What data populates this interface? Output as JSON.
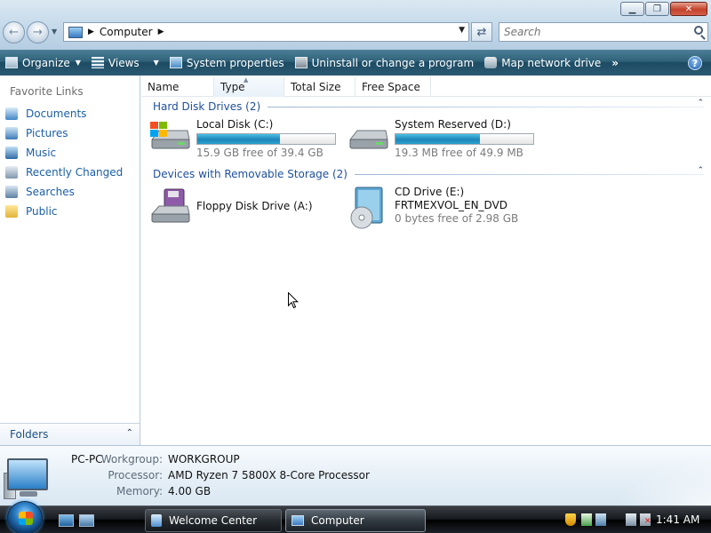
{
  "window": {
    "minimize_glyph": "▁",
    "maximize_glyph": "❐",
    "close_glyph": "✕"
  },
  "nav": {
    "back_glyph": "←",
    "forward_glyph": "→",
    "history_glyph": "▼"
  },
  "address": {
    "crumb_arrow": "▶",
    "crumb": "Computer",
    "crumb_trailing_arrow": "▶",
    "dropdown_glyph": "▼",
    "refresh_glyph": "⇄"
  },
  "search": {
    "placeholder": "Search"
  },
  "toolbar": {
    "organize": "Organize",
    "views": "Views",
    "system_properties": "System properties",
    "uninstall": "Uninstall or change a program",
    "map_network": "Map network drive",
    "more": "»",
    "help": "?",
    "dropdown_glyph": "▼"
  },
  "sidebar": {
    "title": "Favorite Links",
    "items": [
      {
        "label": "Documents",
        "icon": "documents-icon"
      },
      {
        "label": "Pictures",
        "icon": "pictures-icon"
      },
      {
        "label": "Music",
        "icon": "music-icon"
      },
      {
        "label": "Recently Changed",
        "icon": "recently-changed-icon"
      },
      {
        "label": "Searches",
        "icon": "searches-icon"
      },
      {
        "label": "Public",
        "icon": "public-folder-icon"
      }
    ],
    "folders_label": "Folders",
    "folders_chevron": "⌃"
  },
  "columns": {
    "name": "Name",
    "type": "Type",
    "total_size": "Total Size",
    "free_space": "Free Space",
    "sort_glyph": "▲"
  },
  "groups": {
    "hard_disks": "Hard Disk Drives (2)",
    "removable": "Devices with Removable Storage (2)",
    "collapse_glyph": "⌃"
  },
  "drives": {
    "c": {
      "name": "Local Disk (C:)",
      "free_text": "15.9 GB free of 39.4 GB",
      "used_fraction": 0.6
    },
    "d": {
      "name": "System Reserved (D:)",
      "free_text": "19.3 MB free of 49.9 MB",
      "used_fraction": 0.61
    },
    "a": {
      "name": "Floppy Disk Drive (A:)"
    },
    "e": {
      "name": "CD Drive (E:)",
      "label": "FRTMEXVOL_EN_DVD",
      "free_text": "0 bytes free of 2.98 GB"
    }
  },
  "details": {
    "pc_name": "PC-PC",
    "workgroup_label": "Workgroup:",
    "workgroup": "WORKGROUP",
    "processor_label": "Processor:",
    "processor": "AMD Ryzen 7 5800X 8-Core Processor",
    "memory_label": "Memory:",
    "memory": "4.00 GB"
  },
  "taskbar": {
    "buttons": [
      {
        "label": "Welcome Center"
      },
      {
        "label": "Computer"
      }
    ],
    "clock": "1:41 AM"
  },
  "colors": {
    "link_blue": "#1a5ea8",
    "group_blue": "#1e4f9c",
    "bar_fill": "#1d86b9"
  }
}
